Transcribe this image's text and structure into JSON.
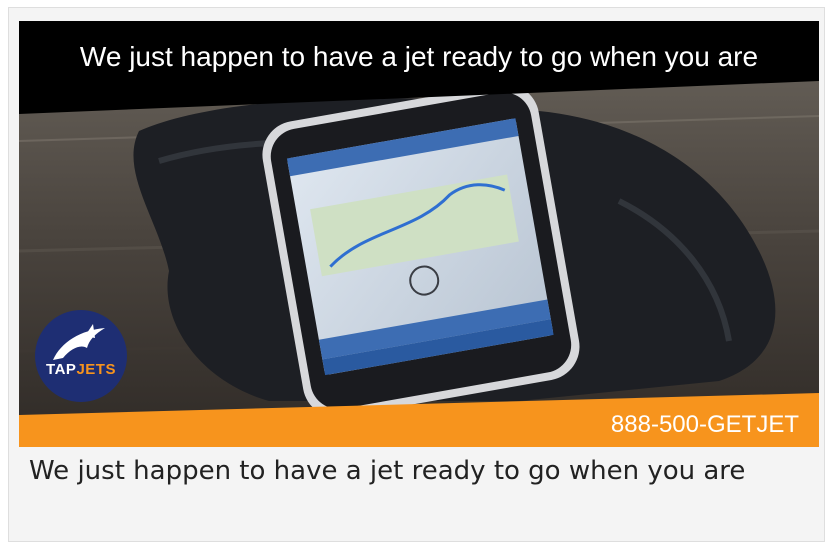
{
  "banner": {
    "headline": "We just happen to have a jet ready to go when you are",
    "phone_number": "888-500-GETJET",
    "logo": {
      "brand_main": "TAP",
      "brand_accent": "JETS",
      "icon": "dolphin-jet-icon"
    }
  },
  "caption": "We just happen to have a jet ready to go when you are",
  "colors": {
    "accent": "#f7941d",
    "title_bar": "#000000",
    "logo_navy": "#1e2e73"
  }
}
